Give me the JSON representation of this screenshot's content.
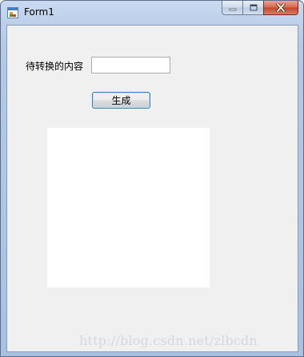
{
  "window": {
    "title": "Form1",
    "controls": {
      "minimize": "minimize",
      "maximize": "maximize",
      "close": "close"
    }
  },
  "form": {
    "label_text": "待转换的内容",
    "input_value": "",
    "generate_button_label": "生成",
    "picture_box": "empty"
  },
  "watermark": "http://blog.csdn.net/zlbcdn",
  "colors": {
    "client_background": "#f0f0f0",
    "button_border_accent": "#3c7fb1",
    "close_button": "#c3442b",
    "title_bar": "#bcd0ea"
  },
  "icons": [
    "form-app-icon",
    "minimize-icon",
    "maximize-icon",
    "close-icon"
  ]
}
